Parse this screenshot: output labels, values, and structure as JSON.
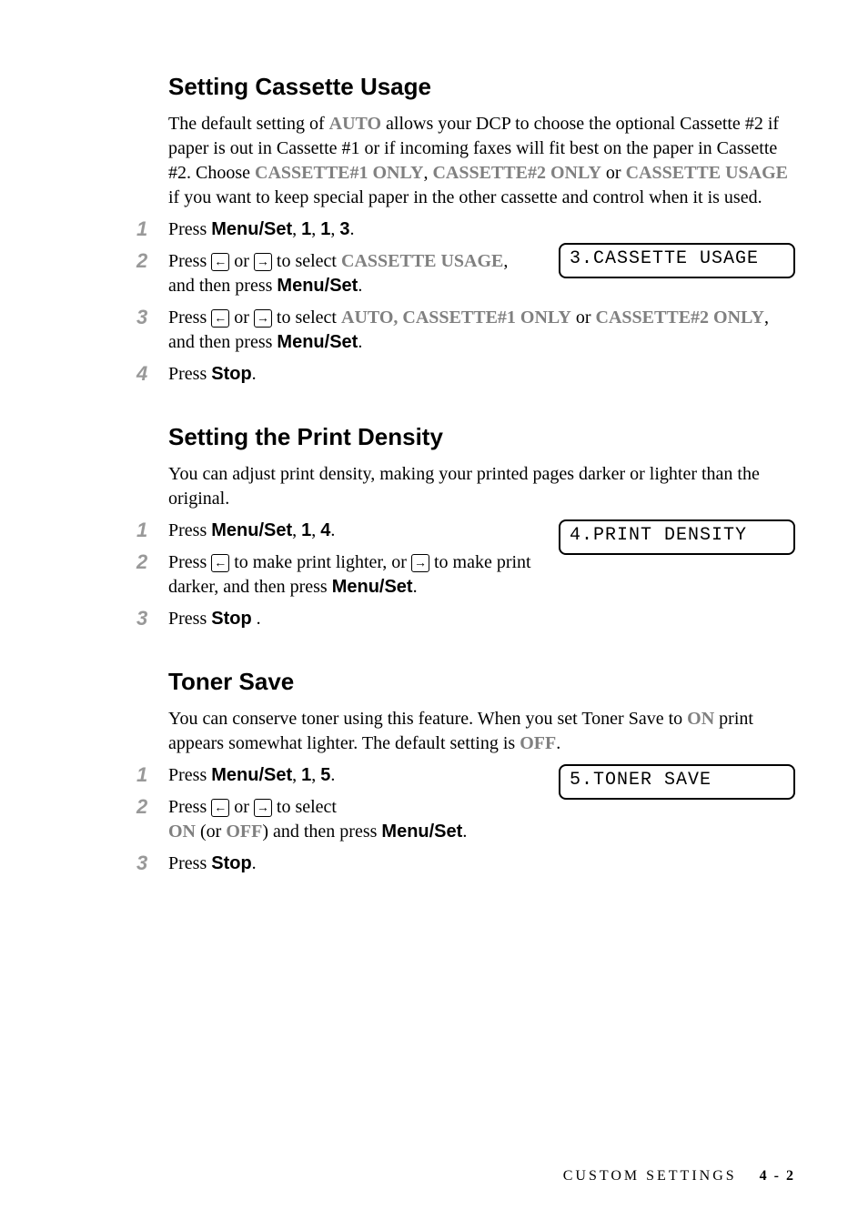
{
  "sections": {
    "cassette": {
      "heading": "Setting Cassette Usage",
      "intro_pre": "The default setting of ",
      "intro_auto": "AUTO",
      "intro_mid1": " allows your DCP to choose the optional Cassette #2 if paper is out in Cassette #1 or if incoming faxes will fit best on the paper in Cassette #2. Choose ",
      "cass1": "CASSETTE#1 ONLY",
      "comma": ", ",
      "cass2": "CASSETTE#2 ONLY",
      "or": " or ",
      "cassusage": "CASSETTE USAGE",
      "intro_end": " if you want to keep special paper in the other cassette and control when it is used.",
      "display": "3.CASSETTE USAGE",
      "steps": {
        "s1_pre": "Press ",
        "s1_bold": "Menu/Set",
        "s1_post": ", ",
        "s1_k1": "1",
        "s1_k2": "1",
        "s1_k3": "3",
        "s1_dot": ".",
        "s2_pre": "Press ",
        "s2_or": " or ",
        "s2_mid": " to select ",
        "s2_sel": "CASSETTE USAGE",
        "s2_post": ", and then press ",
        "s2_bold": "Menu/Set",
        "s2_dot": ".",
        "s3_pre": "Press ",
        "s3_or": " or ",
        "s3_mid": " to select ",
        "s3_auto": "AUTO",
        "s3_gcomma": ", ",
        "s3_c1": "CASSETTE#1 ONLY",
        "s3_or2": " or ",
        "s3_c2": "CASSETTE#2 ONLY",
        "s3_post": ", and then press ",
        "s3_bold": "Menu/Set",
        "s3_dot": ".",
        "s4_pre": "Press ",
        "s4_bold": "Stop",
        "s4_dot": "."
      }
    },
    "density": {
      "heading": "Setting the Print Density",
      "intro": "You can adjust print density, making your printed pages darker or lighter than the original.",
      "display": "4.PRINT DENSITY",
      "steps": {
        "s1_pre": "Press ",
        "s1_bold": "Menu/Set",
        "s1_post": ", ",
        "s1_k1": "1",
        "s1_k2": "4",
        "s1_dot": ".",
        "s2_pre": "Press ",
        "s2_mid1": " to make print lighter, or ",
        "s2_mid2": " to make print darker, and then press ",
        "s2_bold": "Menu/Set",
        "s2_dot": ".",
        "s3_pre": "Press ",
        "s3_bold": "Stop",
        "s3_dot": " ."
      }
    },
    "toner": {
      "heading": "Toner Save",
      "intro_pre": "You can conserve toner using this feature. When you set Toner Save to ",
      "intro_on": "ON",
      "intro_mid": " print appears somewhat lighter. The default setting is ",
      "intro_off": "OFF",
      "intro_end": ".",
      "display": "5.TONER SAVE",
      "steps": {
        "s1_pre": "Press ",
        "s1_bold": "Menu/Set",
        "s1_post": ", ",
        "s1_k1": "1",
        "s1_k2": "5",
        "s1_dot": ".",
        "s2_pre": "Press ",
        "s2_or": " or ",
        "s2_mid": " to select",
        "s2_on": "ON",
        "s2_paren_open": " (or ",
        "s2_off": "OFF",
        "s2_paren_close": ") and then press ",
        "s2_bold": "Menu/Set",
        "s2_dot": ".",
        "s3_pre": "Press ",
        "s3_bold": "Stop",
        "s3_dot": "."
      }
    }
  },
  "footer": {
    "section_name": "CUSTOM SETTINGS",
    "page": "4 - 2"
  },
  "nums": {
    "n1": "1",
    "n2": "2",
    "n3": "3",
    "n4": "4"
  },
  "icons": {
    "left": "←",
    "right": "→"
  }
}
